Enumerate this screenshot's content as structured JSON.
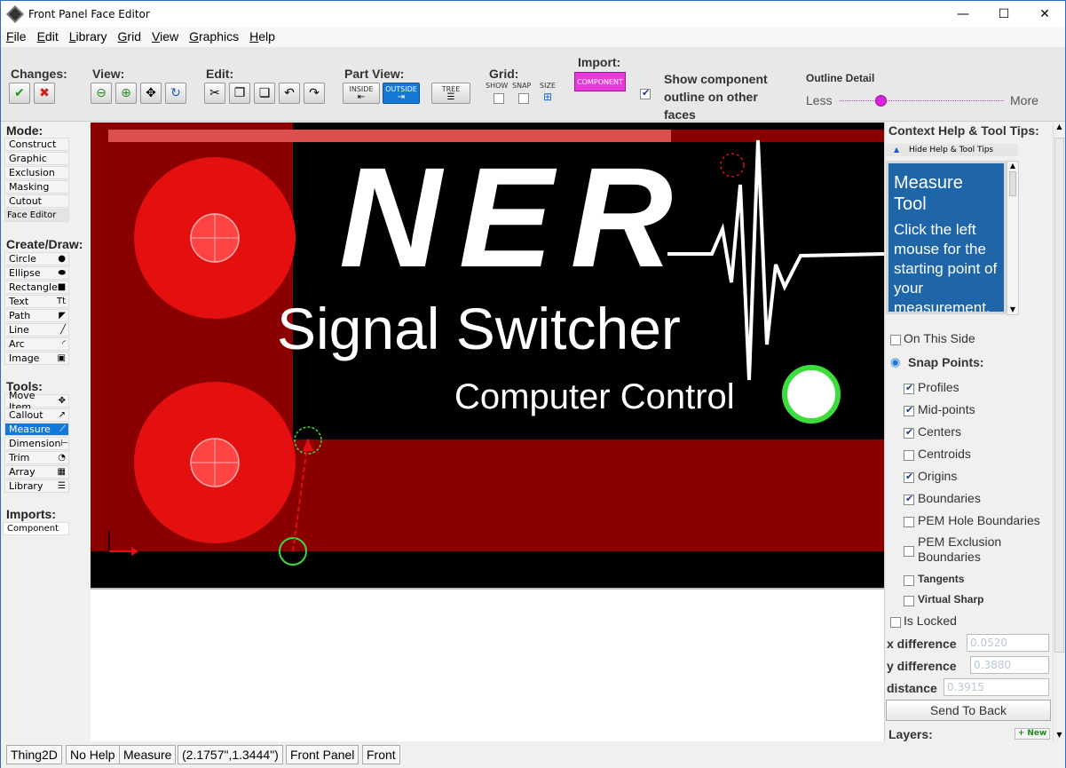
{
  "window": {
    "title": "Front Panel Face Editor",
    "minimize": "—",
    "maximize": "☐",
    "close": "✕"
  },
  "menu": [
    "File",
    "Edit",
    "Library",
    "Grid",
    "View",
    "Graphics",
    "Help"
  ],
  "toolbar": {
    "changes_label": "Changes:",
    "view_label": "View:",
    "edit_label": "Edit:",
    "part_view_label": "Part View:",
    "part_view_inside": "INSIDE",
    "part_view_outside": "OUTSIDE",
    "tree_label": "TREE",
    "grid_label": "Grid:",
    "grid_show": "SHOW",
    "grid_snap": "SNAP",
    "grid_size": "SIZE",
    "import_label": "Import:",
    "import_component": "COMPONENT",
    "show_outline": "Show component outline on other faces",
    "outline_detail": "Outline Detail",
    "outline_less": "Less",
    "outline_more": "More",
    "outline_level": 0.14
  },
  "left": {
    "mode_label": "Mode:",
    "modes": [
      "Construct",
      "Graphic",
      "Exclusion",
      "Masking",
      "Cutout",
      "Face Editor"
    ],
    "create_label": "Create/Draw:",
    "create": [
      {
        "label": "Circle",
        "icon": "●"
      },
      {
        "label": "Ellipse",
        "icon": "⬬"
      },
      {
        "label": "Rectangle",
        "icon": "■"
      },
      {
        "label": "Text",
        "icon": "Tt"
      },
      {
        "label": "Path",
        "icon": "◤"
      },
      {
        "label": "Line",
        "icon": "╱"
      },
      {
        "label": "Arc",
        "icon": "◜"
      },
      {
        "label": "Image",
        "icon": "▣"
      }
    ],
    "tools_label": "Tools:",
    "tools": [
      {
        "label": "Move Item",
        "icon": "✥"
      },
      {
        "label": "Callout",
        "icon": "↗"
      },
      {
        "label": "Measure",
        "icon": "⟋"
      },
      {
        "label": "Dimension",
        "icon": "⊢"
      },
      {
        "label": "Trim",
        "icon": "◔"
      },
      {
        "label": "Array",
        "icon": "▦"
      },
      {
        "label": "Library",
        "icon": "☰"
      }
    ],
    "imports_label": "Imports:",
    "imports": [
      "Component"
    ]
  },
  "canvas": {
    "logo": "NER",
    "title_text": "Signal Switcher",
    "subtitle_text": "Computer Control"
  },
  "right": {
    "help_title": "Context Help & Tool Tips:",
    "hide_help": "Hide Help & Tool Tips",
    "help_heading": "Measure Tool",
    "help_body": "Click the left mouse for the starting point of your measurement.",
    "on_this_side": "On This Side",
    "snap_points": "Snap Points:",
    "snaps": [
      {
        "label": "Profiles",
        "checked": true
      },
      {
        "label": "Mid-points",
        "checked": true
      },
      {
        "label": "Centers",
        "checked": true
      },
      {
        "label": "Centroids",
        "checked": false
      },
      {
        "label": "Origins",
        "checked": true
      },
      {
        "label": "Boundaries",
        "checked": true
      },
      {
        "label": "PEM Hole Boundaries",
        "checked": false
      }
    ],
    "pem_exclusion": "PEM Exclusion Boundaries",
    "tangents": "Tangents",
    "virtual_sharp": "Virtual Sharp",
    "is_locked": "Is Locked",
    "x_diff_label": "x difference",
    "x_diff": "0.0520",
    "y_diff_label": "y difference",
    "y_diff": "0.3880",
    "distance_label": "distance",
    "distance": "0.3915",
    "send_back": "Send To Back",
    "layers": "Layers:",
    "new_layer": "+ New"
  },
  "status": [
    "Thing2D",
    "No Help",
    "Measure",
    "(2.1757\",1.3444\")",
    "Front Panel",
    "Front"
  ]
}
